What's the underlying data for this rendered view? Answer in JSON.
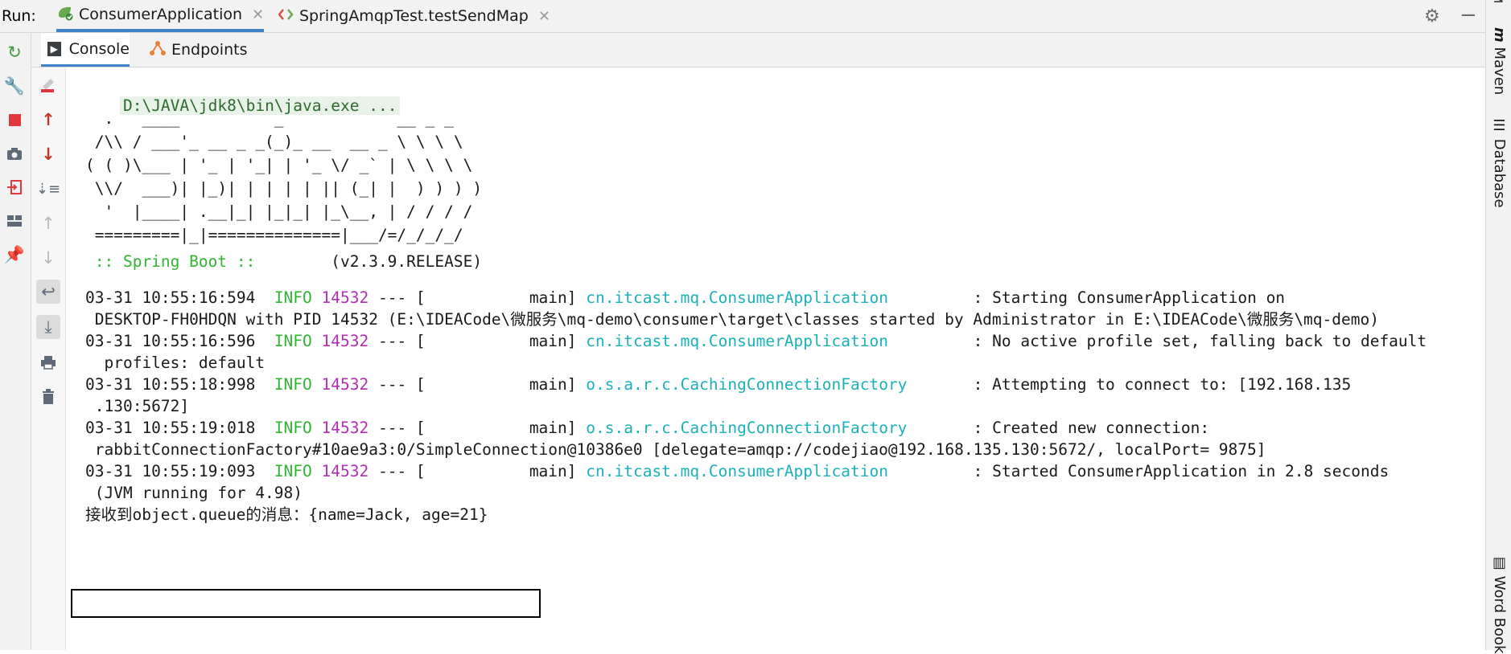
{
  "runbar": {
    "label": "Run:",
    "tabs": [
      {
        "label": "ConsumerApplication",
        "icon": "spring-boot-icon"
      },
      {
        "label": "SpringAmqpTest.testSendMap",
        "icon": "test-icon"
      }
    ]
  },
  "subtabs": [
    {
      "label": "Console",
      "icon": "console-icon"
    },
    {
      "label": "Endpoints",
      "icon": "endpoints-icon"
    }
  ],
  "right_strip": [
    "Maven",
    "Database",
    "Word Book"
  ],
  "console": {
    "command": "D:\\JAVA\\jdk8\\bin\\java.exe ...",
    "banner": [
      "  .   ____          _            __ _ _",
      " /\\\\ / ___'_ __ _ _(_)_ __  __ _ \\ \\ \\ \\",
      "( ( )\\___ | '_ | '_| | '_ \\/ _` | \\ \\ \\ \\",
      " \\\\/  ___)| |_)| | | | | || (_| |  ) ) ) )",
      "  '  |____| .__|_| |_|_| |_\\__, | / / / /",
      " =========|_|==============|___/=/_/_/_/"
    ],
    "spring_boot_label": " :: Spring Boot :: ",
    "spring_boot_version": "       (v2.3.9.RELEASE)",
    "logs": [
      {
        "timestamp": "03-31 10:55:16:594",
        "level": "INFO",
        "pid": "14532",
        "thread": " --- [           main] ",
        "logger": "cn.itcast.mq.ConsumerApplication",
        "pad": "         ",
        "message": ": Starting ConsumerApplication on",
        "cont": " DESKTOP-FH0HDQN with PID 14532 (E:\\IDEACode\\微服务\\mq-demo\\consumer\\target\\classes started by Administrator in E:\\IDEACode\\微服务\\mq-demo)"
      },
      {
        "timestamp": "03-31 10:55:16:596",
        "level": "INFO",
        "pid": "14532",
        "thread": " --- [           main] ",
        "logger": "cn.itcast.mq.ConsumerApplication",
        "pad": "         ",
        "message": ": No active profile set, falling back to default",
        "cont": "  profiles: default"
      },
      {
        "timestamp": "03-31 10:55:18:998",
        "level": "INFO",
        "pid": "14532",
        "thread": " --- [           main] ",
        "logger": "o.s.a.r.c.CachingConnectionFactory",
        "pad": "       ",
        "message": ": Attempting to connect to: [192.168.135",
        "cont": " .130:5672]"
      },
      {
        "timestamp": "03-31 10:55:19:018",
        "level": "INFO",
        "pid": "14532",
        "thread": " --- [           main] ",
        "logger": "o.s.a.r.c.CachingConnectionFactory",
        "pad": "       ",
        "message": ": Created new connection:",
        "cont": " rabbitConnectionFactory#10ae9a3:0/SimpleConnection@10386e0 [delegate=amqp://codejiao@192.168.135.130:5672/, localPort= 9875]"
      },
      {
        "timestamp": "03-31 10:55:19:093",
        "level": "INFO",
        "pid": "14532",
        "thread": " --- [           main] ",
        "logger": "cn.itcast.mq.ConsumerApplication",
        "pad": "         ",
        "message": ": Started ConsumerApplication in 2.8 seconds",
        "cont": " (JVM running for 4.98)"
      }
    ],
    "received": "接收到object.queue的消息：{name=Jack, age=21}"
  },
  "colors": {
    "info": "#2fb52f",
    "pid": "#b32eb3",
    "logger": "#1ab1b8",
    "accent": "#4083c9"
  }
}
